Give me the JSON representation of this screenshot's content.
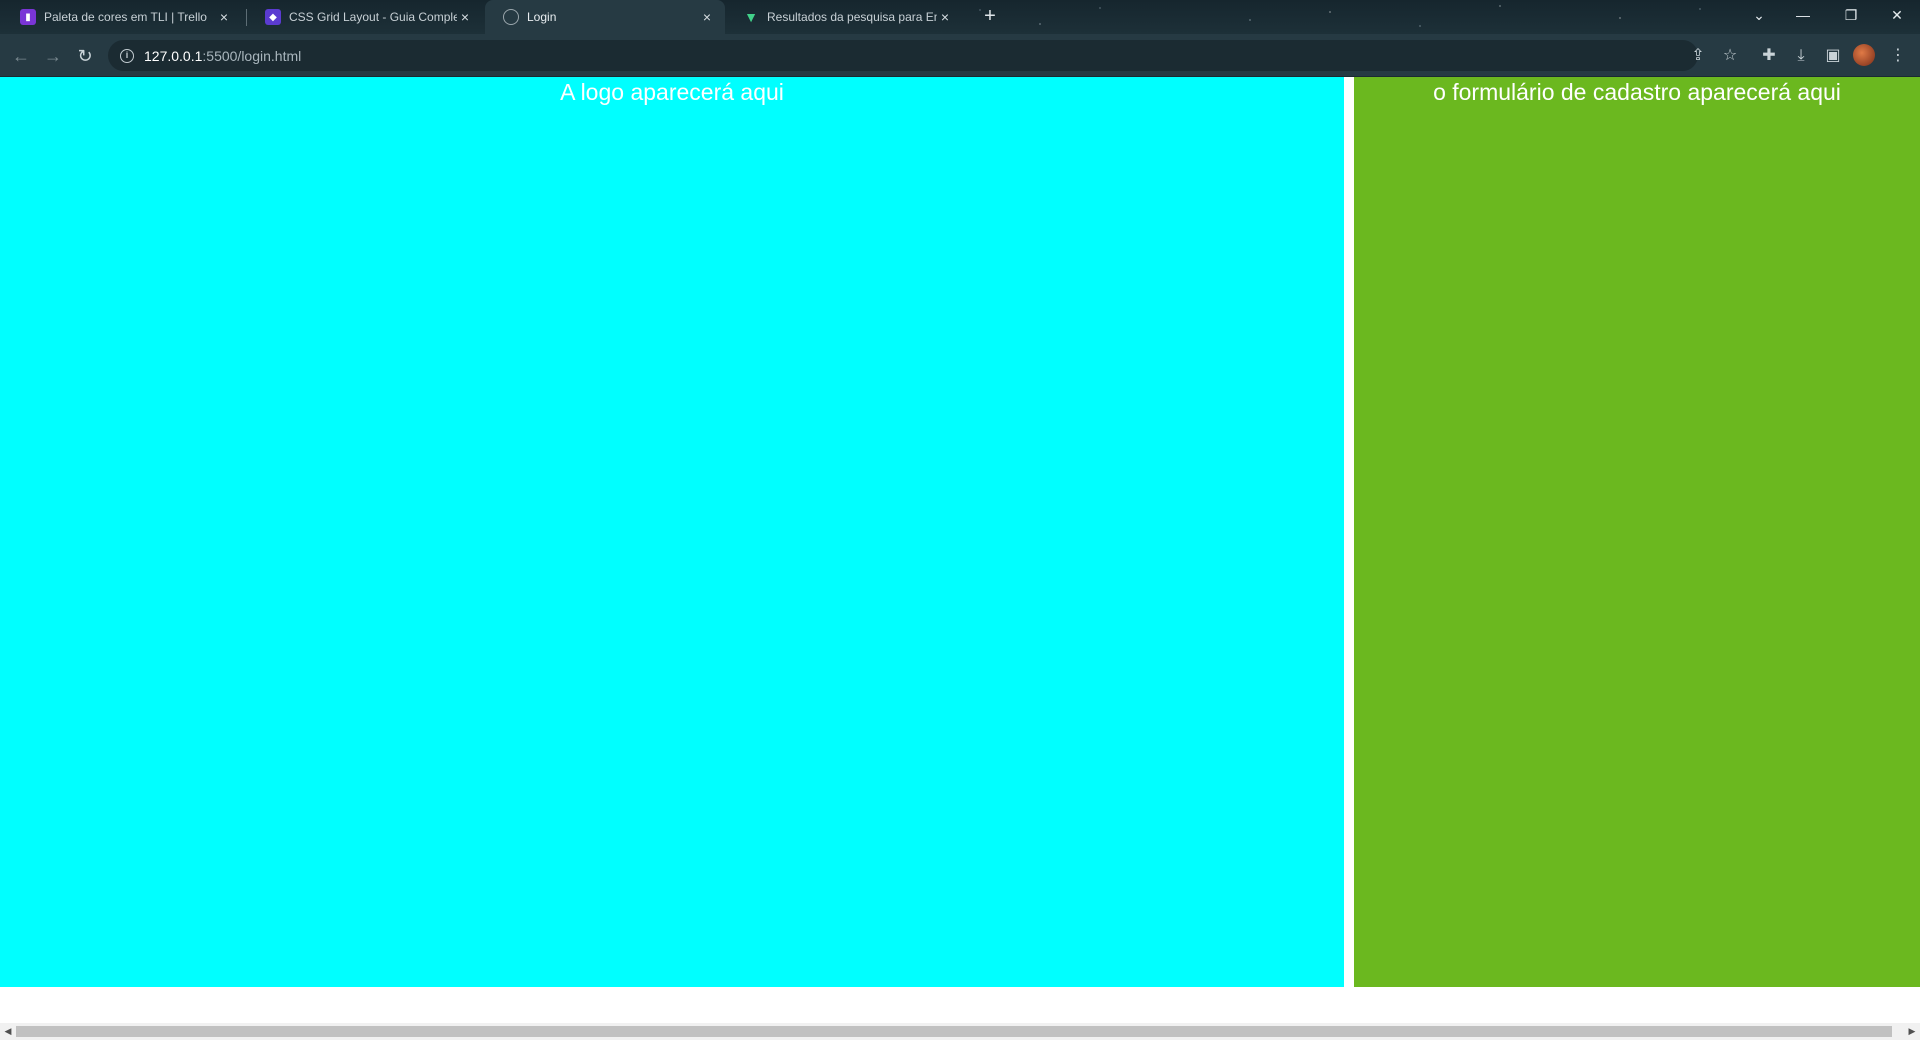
{
  "browser": {
    "tabs": [
      {
        "title": "Paleta de cores em TLI | Trello",
        "icon": "trello-icon",
        "close": "×"
      },
      {
        "title": "CSS Grid Layout - Guia Complet",
        "icon": "shield-icon",
        "close": "×"
      },
      {
        "title": "Login",
        "icon": "globe-icon",
        "close": "×"
      },
      {
        "title": "Resultados da pesquisa para Em",
        "icon": "vue-icon",
        "close": "×"
      }
    ],
    "new_tab": "+",
    "window_controls": {
      "tab_search": "⌄",
      "minimize": "—",
      "restore": "❐",
      "close": "✕"
    },
    "url_host": "127.0.0.1",
    "url_rest": ":5500/login.html",
    "nav": {
      "back": "←",
      "forward": "→",
      "reload": "↻"
    },
    "toolbar_icons": {
      "share": "⇪",
      "bookmark": "☆",
      "extensions": "✚",
      "download": "⤓",
      "sidepanel": "▣",
      "menu": "⋮"
    }
  },
  "page": {
    "logo_panel_text": "A logo aparecerá aqui",
    "form_panel_text": "o formulário de cadastro aparecerá aqui",
    "colors": {
      "logo_panel": "#00ffff",
      "form_panel": "#6bb81f"
    }
  },
  "scrollbar": {
    "left_arrow": "◀",
    "right_arrow": "▶"
  }
}
